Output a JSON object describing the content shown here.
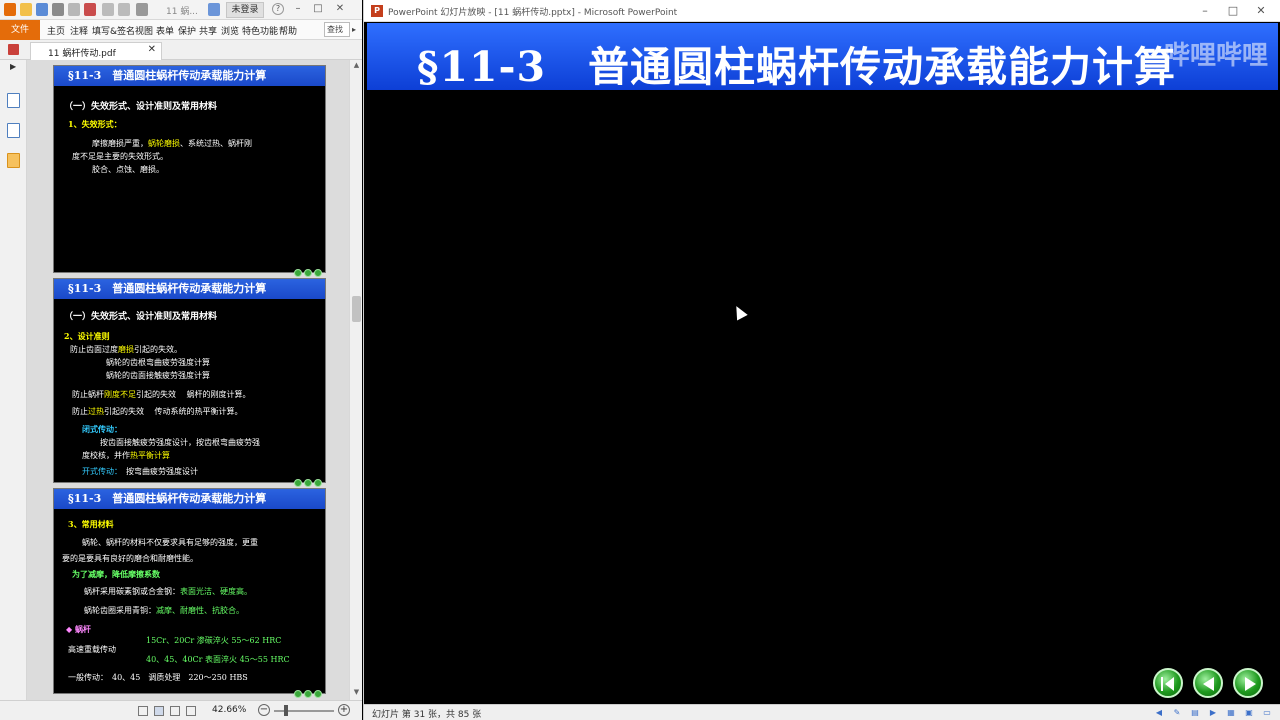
{
  "pdf_reader": {
    "quick_access": {
      "tab_label": "11 蜗...",
      "login_label": "未登录"
    },
    "menu": {
      "file": "文件",
      "items": [
        "主页",
        "注释",
        "填写&签名",
        "视图",
        "表单",
        "保护",
        "共享",
        "浏览",
        "特色功能",
        "帮助"
      ],
      "search_placeholder": "查找"
    },
    "document_tab": {
      "name": "11 蜗杆传动.pdf",
      "close": "✕"
    },
    "pages": [
      {
        "header": "§11-3　普通圆柱蜗杆传动承载能力计算",
        "lines": [
          {
            "text": "（一）失效形式、设计准则及常用材料",
            "color": "white"
          },
          {
            "text": "1、失效形式：",
            "color": "yellow"
          },
          {
            "text": "摩擦磨损严重，蜗轮磨损、系统过热、蜗杆刚",
            "color": "white"
          },
          {
            "text": "度不足是主要的失效形式。",
            "color": "white"
          },
          {
            "text": "胶合、点蚀、磨损。",
            "color": "white"
          }
        ]
      },
      {
        "header": "§11-3　普通圆柱蜗杆传动承载能力计算",
        "lines": [
          {
            "text": "（一）失效形式、设计准则及常用材料",
            "color": "white"
          },
          {
            "text": "2、设计准则",
            "color": "yellow"
          },
          {
            "text": "防止齿面过度磨损引起的失效。",
            "color": "white"
          },
          {
            "text": "蜗轮的齿根弯曲疲劳强度计算",
            "color": "white"
          },
          {
            "text": "蜗轮的齿面接触疲劳强度计算",
            "color": "white"
          },
          {
            "text": "防止蜗杆刚度不足引起的失效　 蜗杆的刚度计算。",
            "color": "white"
          },
          {
            "text": "防止过热引起的失效　 传动系统的热平衡计算。",
            "color": "white"
          },
          {
            "text": "闭式传动：",
            "color": "cyan"
          },
          {
            "text": "按齿面接触疲劳强度设计，按齿根弯曲疲劳强",
            "color": "white"
          },
          {
            "text": "度校核，并作热平衡计算",
            "color": "white"
          },
          {
            "text": "开式传动：　按弯曲疲劳强度设计",
            "color": "white"
          }
        ]
      },
      {
        "header": "§11-3　普通圆柱蜗杆传动承载能力计算",
        "lines": [
          {
            "text": "3、常用材料",
            "color": "yellow"
          },
          {
            "text": "蜗轮、蜗杆的材料不仅要求具有足够的强度，更重",
            "color": "white"
          },
          {
            "text": "要的是要具有良好的磨合和耐磨性能。",
            "color": "white"
          },
          {
            "text": "为了减摩，降低摩擦系数",
            "color": "green"
          },
          {
            "text": "蜗杆采用碳素钢或合金钢：表面光洁、硬度高。",
            "color": "white"
          },
          {
            "text": "蜗轮齿圈采用青铜：减摩、耐磨性、抗胶合。",
            "color": "white"
          },
          {
            "text": "◆ 蜗杆",
            "color": "magenta"
          },
          {
            "text": "15Cr、20Cr 渗碳淬火 55～62 HRC",
            "color": "green"
          },
          {
            "text": "高速重载传动",
            "color": "white"
          },
          {
            "text": "40、45、40Cr 表面淬火 45～55 HRC",
            "color": "green"
          },
          {
            "text": "一般传动：　40、45　调质处理　220～250 HBS",
            "color": "white"
          }
        ]
      }
    ],
    "status": {
      "zoom": "42.66%"
    }
  },
  "powerpoint": {
    "window_title": "PowerPoint 幻灯片放映 - [11 蜗杆传动.pptx] - Microsoft PowerPoint",
    "slide_title": "§11-3　普通圆柱蜗杆传动承载能力计算",
    "watermark": "哔哩哔哩",
    "status_text": "幻灯片 第 31 张，共 85 张"
  }
}
